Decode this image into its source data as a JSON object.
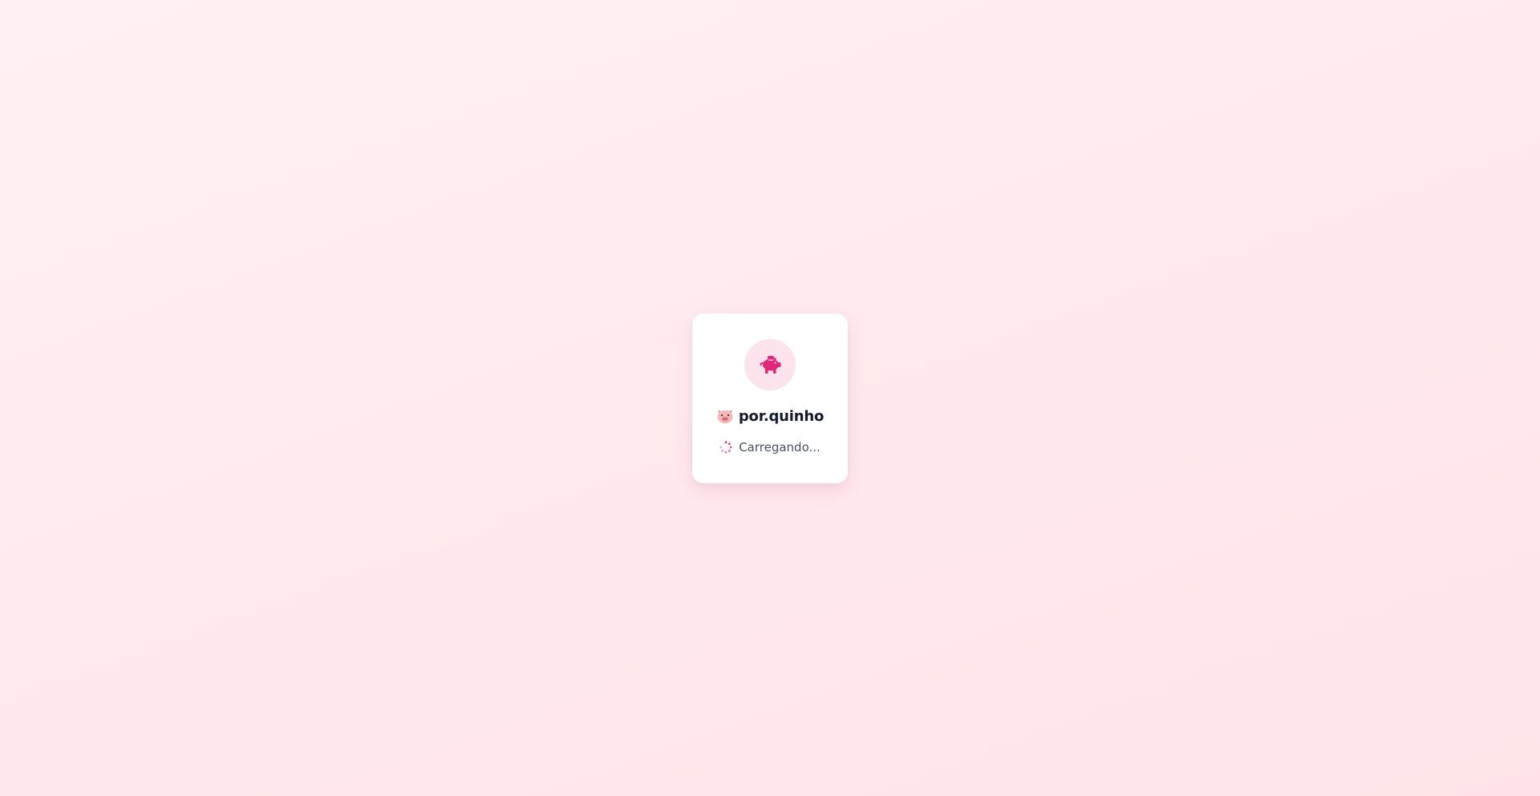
{
  "app": {
    "brand_emoji": "🐷",
    "brand_name": "por.quinho",
    "logo_icon": "piggy-bank-icon"
  },
  "status": {
    "text": "Carregando...",
    "icon": "loading-spinner-icon"
  },
  "colors": {
    "accent": "#e0287a",
    "logo_bg": "#fce3ec",
    "title": "#151a2d",
    "status_text": "#4a5168",
    "background": "#ffecf0"
  }
}
